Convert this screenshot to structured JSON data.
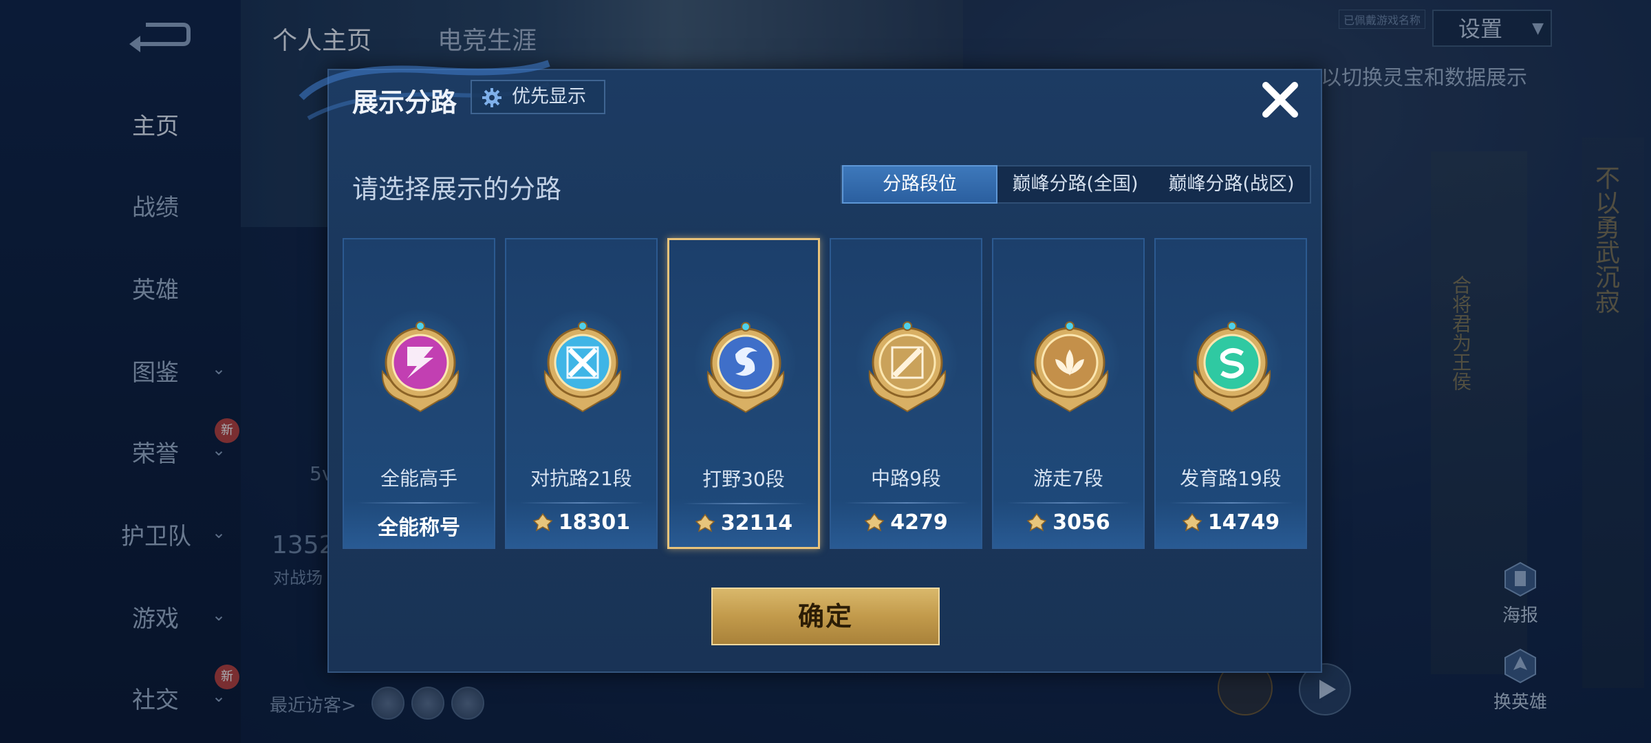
{
  "background": {
    "top_tabs": [
      "个人主页",
      "电竞生涯"
    ],
    "settings_label": "设置",
    "hint_text": "以切换灵宝和数据展示",
    "tag_text": "已佩戴游戏名称",
    "sidebar": [
      {
        "label": "主页",
        "active": true,
        "chevron": false,
        "new": false
      },
      {
        "label": "战绩",
        "active": false,
        "chevron": false,
        "new": false
      },
      {
        "label": "英雄",
        "active": false,
        "chevron": false,
        "new": false
      },
      {
        "label": "图鉴",
        "active": false,
        "chevron": true,
        "new": false
      },
      {
        "label": "荣誉",
        "active": false,
        "chevron": true,
        "new": true
      },
      {
        "label": "护卫队",
        "active": false,
        "chevron": true,
        "new": false
      },
      {
        "label": "游戏",
        "active": false,
        "chevron": true,
        "new": false
      },
      {
        "label": "社交",
        "active": false,
        "chevron": true,
        "new": true
      }
    ],
    "new_badge": "新",
    "stat_number": "1352",
    "stat_caption": "对战场",
    "stat_5v": "5v",
    "recent_visitors_label": "最近访客>",
    "right_buttons": [
      "海报",
      "换英雄"
    ],
    "scroll_text_1": "不以勇武沉寂",
    "scroll_text_2": "合将君为王侯"
  },
  "modal": {
    "title": "展示分路",
    "priority_button": "优先显示",
    "subtitle": "请选择展示的分路",
    "tabs": [
      {
        "label": "分路段位",
        "active": true
      },
      {
        "label": "巅峰分路(全国)",
        "active": false
      },
      {
        "label": "巅峰分路(战区)",
        "active": false
      }
    ],
    "cards": [
      {
        "name": "全能高手",
        "score": "全能称号",
        "has_icon": false,
        "selected": false,
        "medal": "all-round-medal-icon",
        "color": "#c23fb2"
      },
      {
        "name": "对抗路21段",
        "score": "18301",
        "has_icon": true,
        "selected": false,
        "medal": "clash-lane-medal-icon",
        "color": "#3fb5e6"
      },
      {
        "name": "打野30段",
        "score": "32114",
        "has_icon": true,
        "selected": true,
        "medal": "jungle-medal-icon",
        "color": "#3f6fc9"
      },
      {
        "name": "中路9段",
        "score": "4279",
        "has_icon": true,
        "selected": false,
        "medal": "mid-lane-medal-icon",
        "color": "#caa25a"
      },
      {
        "name": "游走7段",
        "score": "3056",
        "has_icon": true,
        "selected": false,
        "medal": "roam-medal-icon",
        "color": "#c4904a"
      },
      {
        "name": "发育路19段",
        "score": "14749",
        "has_icon": true,
        "selected": false,
        "medal": "farm-lane-medal-icon",
        "color": "#2fc9a2"
      }
    ],
    "confirm_label": "确定"
  }
}
